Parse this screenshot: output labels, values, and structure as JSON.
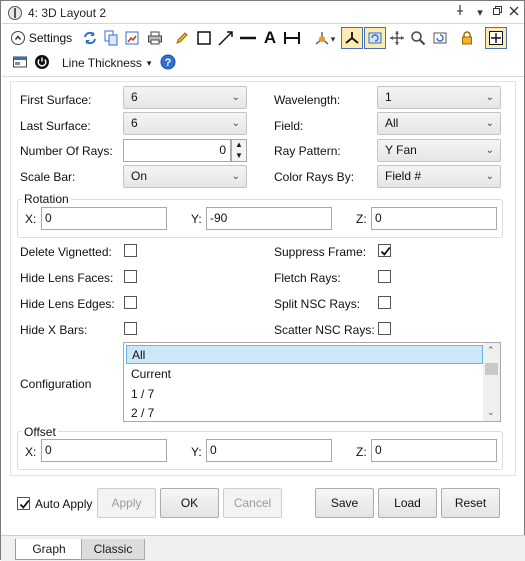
{
  "window": {
    "title": "4: 3D Layout 2",
    "controls": [
      "pin-icon",
      "dropdown-icon",
      "restore-icon",
      "close-icon"
    ]
  },
  "toolbar": {
    "settings_label": "Settings",
    "line_thickness_label": "Line Thickness",
    "line_thickness_arrow": "▾"
  },
  "form": {
    "first_surface": {
      "label": "First Surface:",
      "value": "6"
    },
    "last_surface": {
      "label": "Last Surface:",
      "value": "6"
    },
    "number_of_rays": {
      "label": "Number Of Rays:",
      "value": "0"
    },
    "scale_bar": {
      "label": "Scale Bar:",
      "value": "On"
    },
    "wavelength": {
      "label": "Wavelength:",
      "value": "1"
    },
    "field": {
      "label": "Field:",
      "value": "All"
    },
    "ray_pattern": {
      "label": "Ray Pattern:",
      "value": "Y Fan"
    },
    "color_rays_by": {
      "label": "Color Rays By:",
      "value": "Field #"
    }
  },
  "rotation": {
    "title": "Rotation",
    "x_label": "X:",
    "x_value": "0",
    "y_label": "Y:",
    "y_value": "-90",
    "z_label": "Z:",
    "z_value": "0"
  },
  "checks": {
    "delete_vignetted": {
      "label": "Delete Vignetted:",
      "checked": false
    },
    "hide_lens_faces": {
      "label": "Hide Lens Faces:",
      "checked": false
    },
    "hide_lens_edges": {
      "label": "Hide Lens Edges:",
      "checked": false
    },
    "hide_x_bars": {
      "label": "Hide X Bars:",
      "checked": false
    },
    "suppress_frame": {
      "label": "Suppress Frame:",
      "checked": true
    },
    "fletch_rays": {
      "label": "Fletch Rays:",
      "checked": false
    },
    "split_nsc_rays": {
      "label": "Split NSC Rays:",
      "checked": false
    },
    "scatter_nsc_rays": {
      "label": "Scatter NSC Rays:",
      "checked": false
    }
  },
  "configuration": {
    "label": "Configuration",
    "items": [
      "All",
      "Current",
      "1 / 7",
      "2 / 7"
    ],
    "selected": "All"
  },
  "offset": {
    "title": "Offset",
    "x_label": "X:",
    "x_value": "0",
    "y_label": "Y:",
    "y_value": "0",
    "z_label": "Z:",
    "z_value": "0"
  },
  "buttons": {
    "auto_apply_label": "Auto Apply",
    "auto_apply_checked": true,
    "apply": "Apply",
    "ok": "OK",
    "cancel": "Cancel",
    "save": "Save",
    "load": "Load",
    "reset": "Reset"
  },
  "tabs": [
    {
      "label": "Graph",
      "active": true
    },
    {
      "label": "Classic",
      "active": false
    }
  ],
  "colors": {
    "accent_blue": "#2f6fcf",
    "selection": "#cce8f8",
    "active_tool": "#fdecb0"
  }
}
